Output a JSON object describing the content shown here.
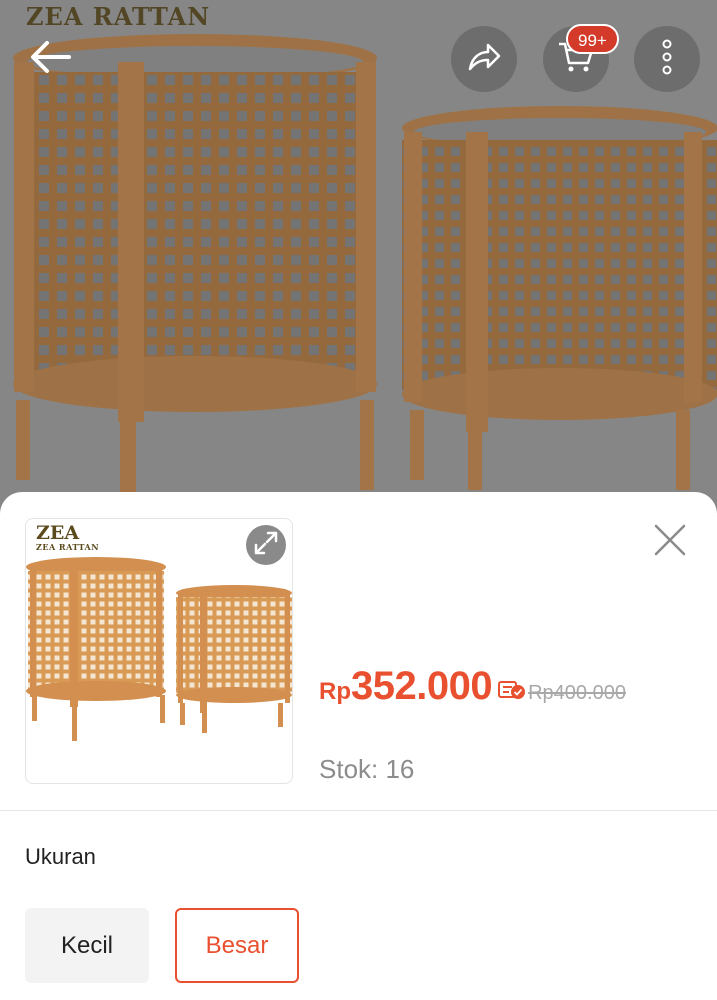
{
  "hero": {
    "brand": "ZEA RATTAN"
  },
  "topbar": {
    "back_icon": "arrow-left-icon",
    "share_icon": "share-icon",
    "cart_icon": "cart-icon",
    "cart_badge": "99+",
    "more_icon": "more-vertical-icon"
  },
  "sheet": {
    "thumb_brand": "ZEA",
    "thumb_brand_sub": "ZEA RATTAN",
    "expand_icon": "expand-icon",
    "close_icon": "close-icon",
    "currency": "Rp",
    "price": "352.000",
    "promo_icon": "discount-tag-icon",
    "original_price": "Rp400.000",
    "stock": "Stok: 16",
    "variant": {
      "title": "Ukuran",
      "options": [
        {
          "label": "Kecil",
          "selected": false
        },
        {
          "label": "Besar",
          "selected": true
        }
      ]
    }
  },
  "colors": {
    "accent": "#e8502f",
    "badge": "#d43a2a",
    "rattan": "#c98a4b"
  }
}
